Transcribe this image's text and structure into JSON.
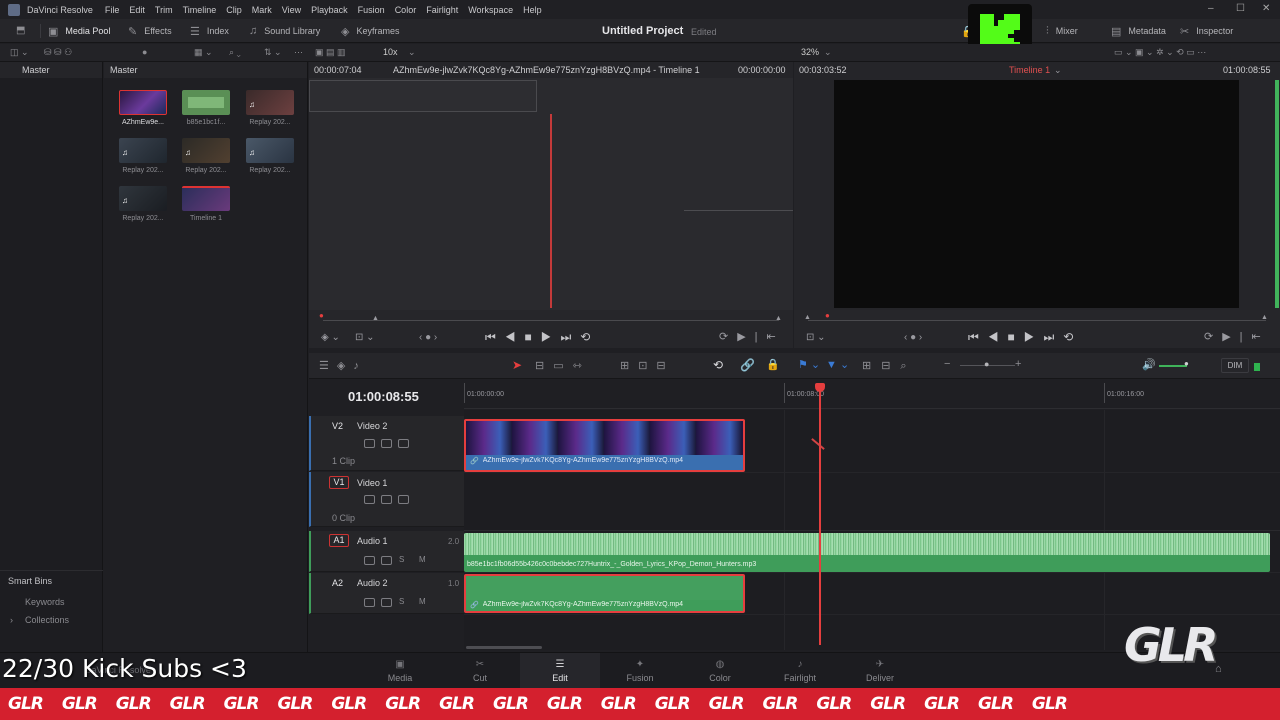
{
  "app": {
    "name": "DaVinci Resolve",
    "menus": [
      "File",
      "Edit",
      "Trim",
      "Timeline",
      "Clip",
      "Mark",
      "View",
      "Playback",
      "Fusion",
      "Color",
      "Fairlight",
      "Workspace",
      "Help"
    ]
  },
  "toolbar": {
    "media_pool": "Media Pool",
    "effects": "Effects",
    "index": "Index",
    "sound_library": "Sound Library",
    "keyframes": "Keyframes",
    "project_title": "Untitled Project",
    "project_status": "Edited",
    "mixer": "Mixer",
    "metadata": "Metadata",
    "inspector": "Inspector"
  },
  "subbar": {
    "src_zoom": "10x",
    "prg_zoom": "32%"
  },
  "bins": {
    "master": "Master",
    "smart_bins": "Smart Bins",
    "keywords": "Keywords",
    "collections": "Collections"
  },
  "pool": {
    "header": "Master",
    "clips": [
      {
        "name": "AZhmEw9e..."
      },
      {
        "name": "b85e1bc1f..."
      },
      {
        "name": "Replay 202..."
      },
      {
        "name": "Replay 202..."
      },
      {
        "name": "Replay 202..."
      },
      {
        "name": "Replay 202..."
      },
      {
        "name": "Replay 202..."
      },
      {
        "name": "Timeline 1"
      }
    ]
  },
  "source_viewer": {
    "timecode_left": "00:00:07:04",
    "clip_title": "AZhmEw9e-jlwZvk7KQc8Yg-AZhmEw9e775znYzgH8BVzQ.mp4 - Timeline 1",
    "timecode_right": "00:00:00:00"
  },
  "program_viewer": {
    "timecode_left": "00:03:03:52",
    "timeline_name": "Timeline 1",
    "timecode_right": "01:00:08:55"
  },
  "timeline": {
    "current_timecode": "01:00:08:55",
    "ruler": [
      "01:00:00:00",
      "01:00:08:00",
      "01:00:16:00"
    ],
    "dim_label": "DIM",
    "tracks": [
      {
        "id": "V2",
        "name": "Video 2",
        "clips": "1 Clip"
      },
      {
        "id": "V1",
        "name": "Video 1",
        "clips": "0 Clip"
      },
      {
        "id": "A1",
        "name": "Audio 1",
        "level": "2.0"
      },
      {
        "id": "A2",
        "name": "Audio 2",
        "level": "1.0"
      }
    ],
    "v2_clip": "AZhmEw9e-jlwZvk7KQc8Yg-AZhmEw9e775znYzgH8BVzQ.mp4",
    "a1_clip": "b85e1bc1fb06d55b426c0c0bebdec727Huntrix_-_Golden_Lyrics_KPop_Demon_Hunters.mp3",
    "a2_clip": "AZhmEw9e-jlwZvk7KQc8Yg-AZhmEw9e775znYzgH8BVzQ.mp4",
    "s_label": "S",
    "m_label": "M"
  },
  "pages": [
    "Media",
    "Cut",
    "Edit",
    "Fusion",
    "Color",
    "Fairlight",
    "Deliver"
  ],
  "overlay": {
    "sub_text": "22/30 Kick Subs <3",
    "resolve_label": "DaVinci Resolve",
    "logo_text": "GLR",
    "k_logo": "K"
  },
  "colors": {
    "accent_red": "#e53e3e",
    "video_clip": "#3a6fb0",
    "audio_clip": "#3f9d5a",
    "ticker_red": "#d4202e",
    "kick_green": "#53fc18"
  }
}
